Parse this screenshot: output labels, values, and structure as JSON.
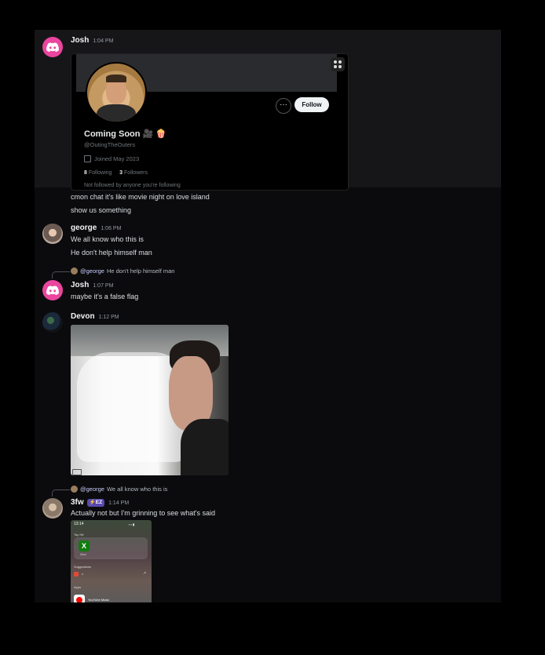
{
  "messages": {
    "josh1": {
      "author": "Josh",
      "time": "1:04 PM",
      "avatar_icon": "discord-logo-icon",
      "lines": [
        "cmon chat it's like movie night on love island",
        "show us something"
      ]
    },
    "embed": {
      "name": "Coming Soon 🎥 🍿",
      "handle": "@OutingTheOuters",
      "joined": "Joined May 2023",
      "following_count": "8",
      "following_label": "Following",
      "followers_count": "3",
      "followers_label": "Followers",
      "not_followed": "Not followed by anyone you're following",
      "follow_label": "Follow",
      "more_label": "···"
    },
    "george": {
      "author": "george",
      "time": "1:06 PM",
      "lines": [
        "We all know who this is",
        "He don't help himself man"
      ]
    },
    "josh2": {
      "reply_user": "@george",
      "reply_text": "He don't help himself man",
      "author": "Josh",
      "time": "1:07 PM",
      "text": "maybe it's a false flag"
    },
    "devon": {
      "author": "Devon",
      "time": "1:12 PM"
    },
    "threefw": {
      "reply_user": "@george",
      "reply_text": "We all know who this is",
      "author": "3fw",
      "badge": "⚡EZ",
      "time": "1:14 PM",
      "text": "Actually not but I'm grinning to see what's said"
    }
  },
  "phone": {
    "clock": "13:14",
    "signal": "▪ ▪ ▮",
    "top_hit": "Top Hit",
    "app_name": "Xbox",
    "xbox_glyph": "X",
    "suggestions": "Suggestions",
    "suggestion_item": "x",
    "arrow": "↗",
    "apps": "Apps",
    "yt_label": "YouTube Music"
  },
  "colors": {
    "background": "#000000",
    "chat_bg": "#0b0b0d",
    "highlight": "#161619",
    "discord_pink": "#eb459e",
    "mention": "#c9cdfb"
  }
}
